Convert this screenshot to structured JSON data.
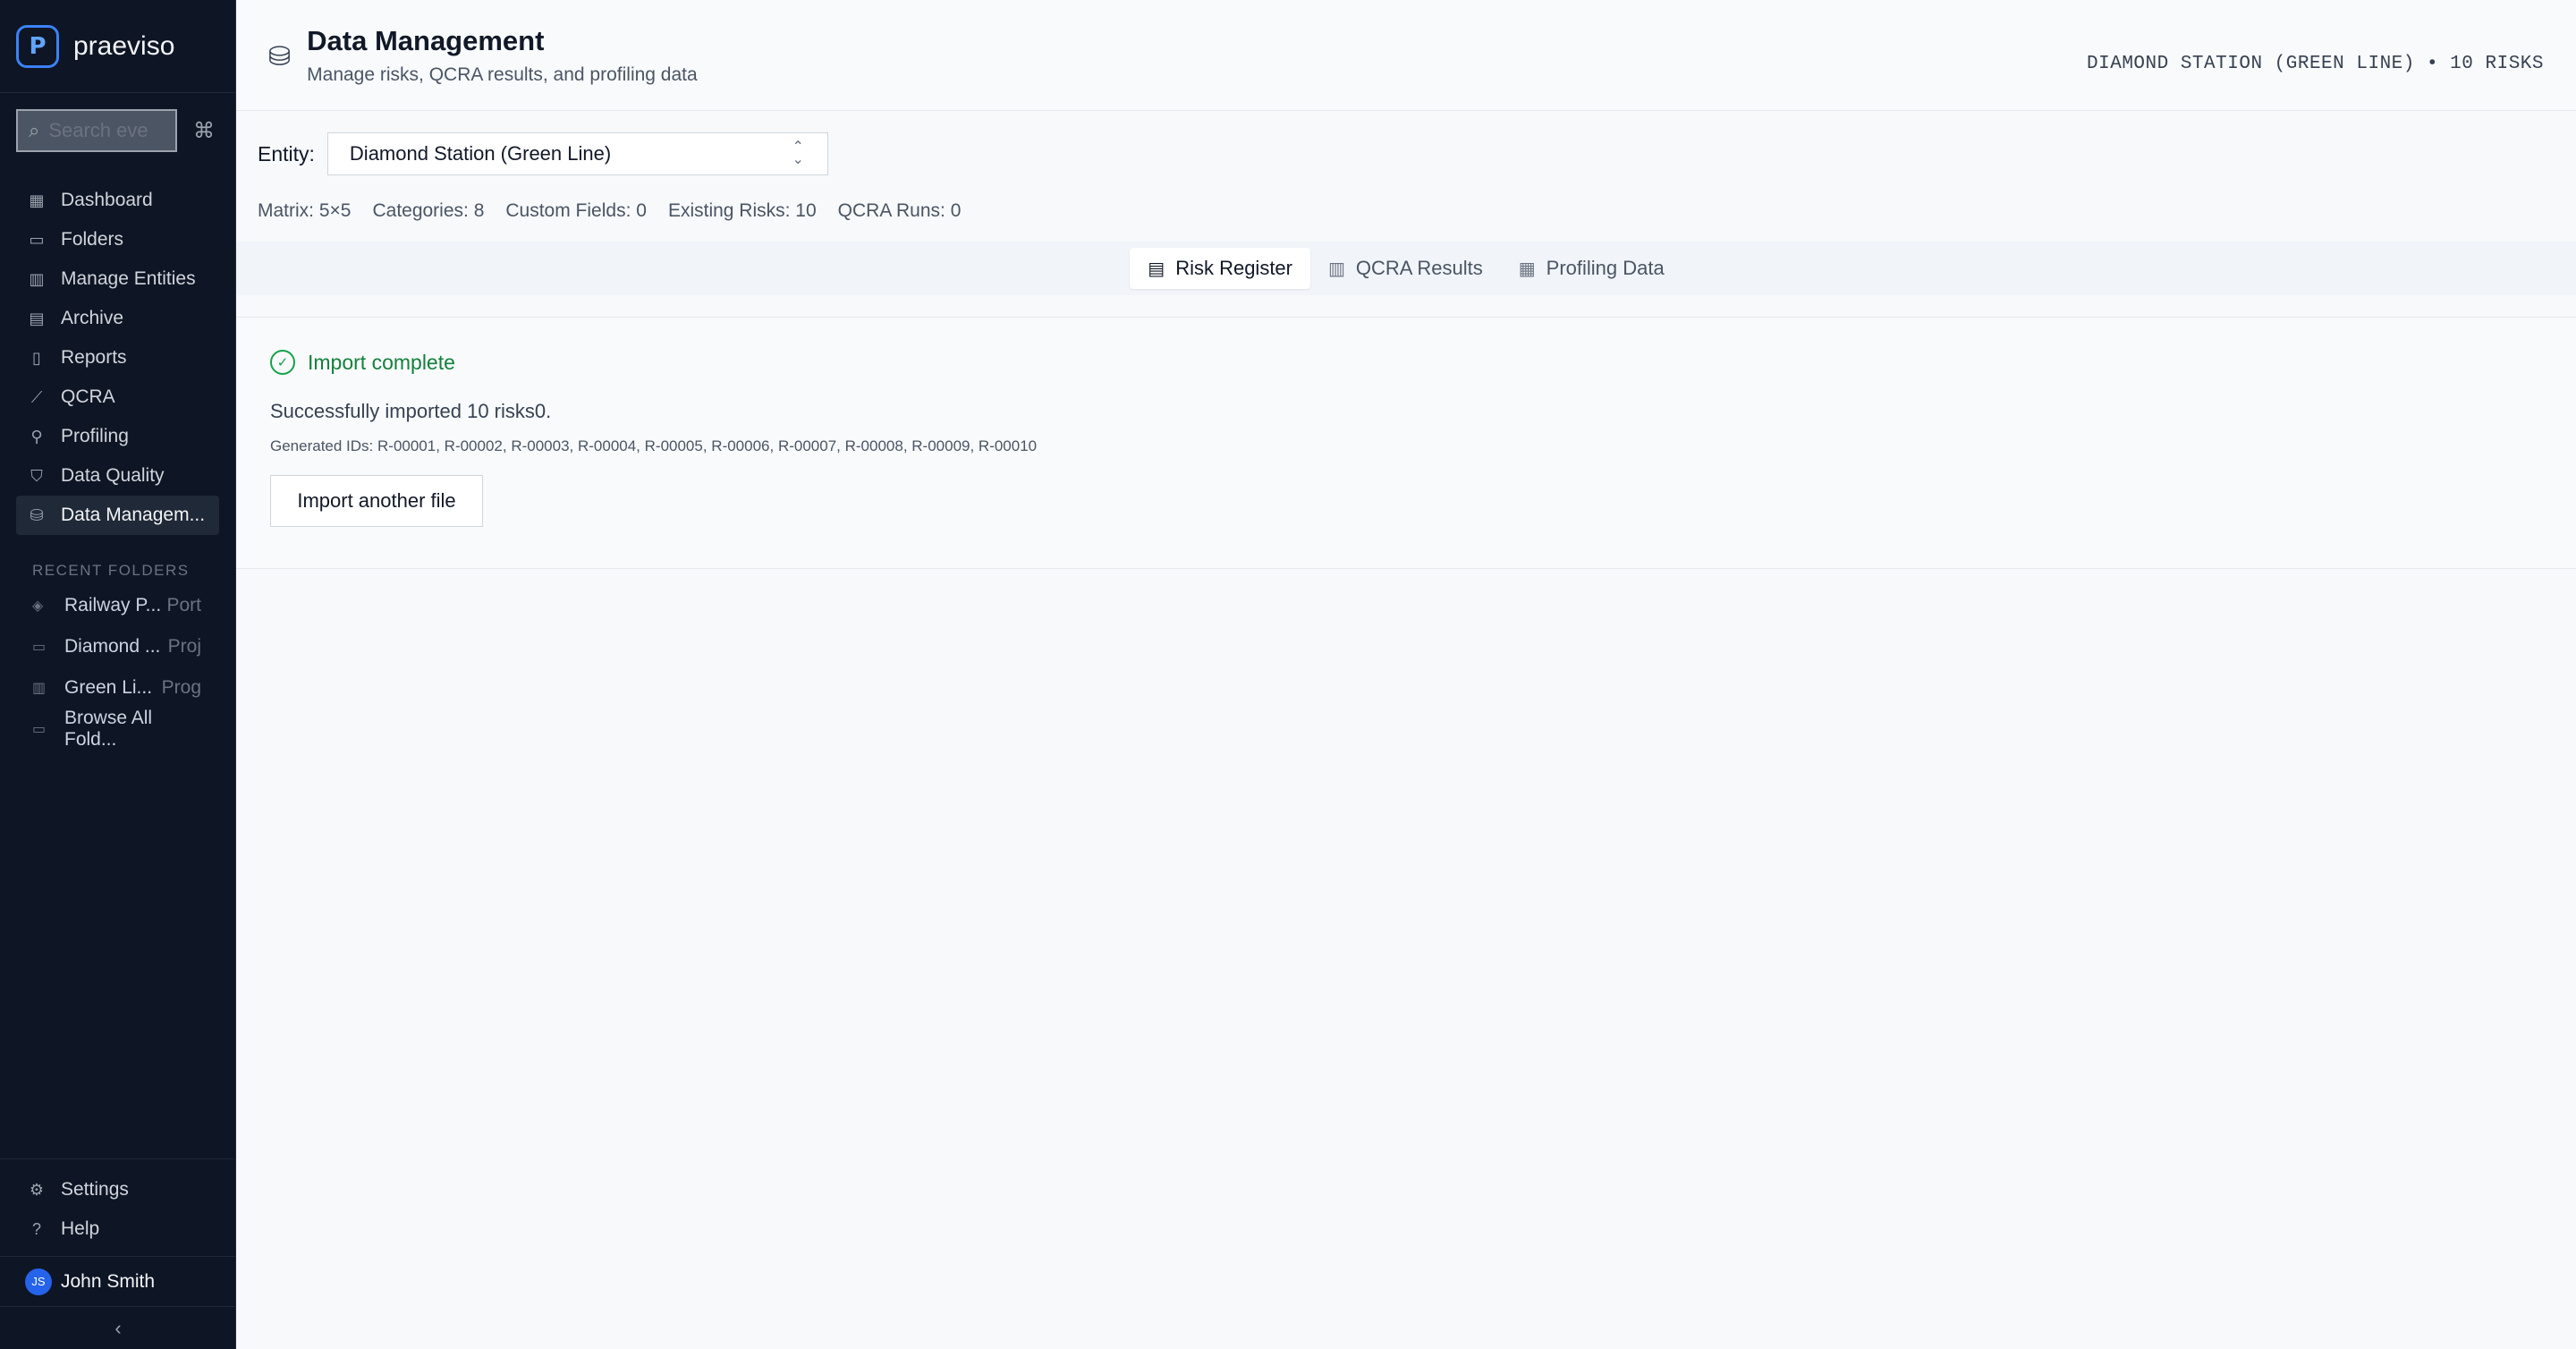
{
  "brand": {
    "logo_letter": "P",
    "name": "praeviso"
  },
  "search": {
    "placeholder": "Search eve",
    "shortcut": "⌘"
  },
  "sidebar": {
    "items": [
      {
        "label": "Dashboard",
        "icon": "dashboard-icon"
      },
      {
        "label": "Folders",
        "icon": "folder-icon"
      },
      {
        "label": "Manage Entities",
        "icon": "building-icon"
      },
      {
        "label": "Archive",
        "icon": "archive-icon"
      },
      {
        "label": "Reports",
        "icon": "report-icon"
      },
      {
        "label": "QCRA",
        "icon": "chart-line-icon"
      },
      {
        "label": "Profiling",
        "icon": "profiling-icon"
      },
      {
        "label": "Data Quality",
        "icon": "shield-icon"
      },
      {
        "label": "Data Managem...",
        "icon": "database-icon",
        "active": true
      }
    ],
    "recent_label": "RECENT FOLDERS",
    "recent": [
      {
        "name": "Railway P...",
        "tag": "Port"
      },
      {
        "name": "Diamond ...",
        "tag": "Proj"
      },
      {
        "name": "Green Li...",
        "tag": "Prog"
      },
      {
        "name": "Browse All Fold...",
        "tag": ""
      }
    ],
    "bottom": [
      {
        "label": "Settings",
        "icon": "gear-icon"
      },
      {
        "label": "Help",
        "icon": "help-icon"
      }
    ],
    "user": {
      "initials": "JS",
      "name": "John Smith"
    }
  },
  "header": {
    "title": "Data Management",
    "subtitle": "Manage risks, QCRA results, and profiling data",
    "context": "DIAMOND STATION (GREEN LINE) • 10 RISKS"
  },
  "entity": {
    "label": "Entity:",
    "value": "Diamond Station (Green Line)"
  },
  "meta": {
    "matrix": "Matrix: 5×5",
    "categories": "Categories: 8",
    "custom_fields": "Custom Fields: 0",
    "existing_risks": "Existing Risks: 10",
    "qcra_runs": "QCRA Runs: 0"
  },
  "tabs": [
    {
      "label": "Risk Register",
      "active": true
    },
    {
      "label": "QCRA Results"
    },
    {
      "label": "Profiling Data"
    }
  ],
  "import_result": {
    "title": "Import complete",
    "message": "Successfully imported 10 risks0.",
    "generated_ids": "Generated IDs: R-00001, R-00002, R-00003, R-00004, R-00005, R-00006, R-00007, R-00008, R-00009, R-00010",
    "button_label": "Import another file"
  },
  "colors": {
    "accent": "#3b82f6",
    "success": "#16a34a",
    "sidebar_bg": "#0e1525"
  }
}
